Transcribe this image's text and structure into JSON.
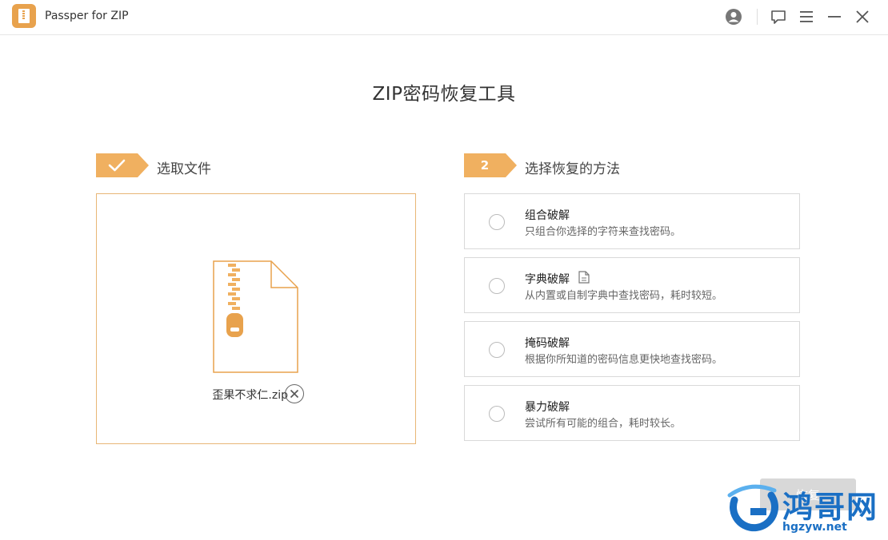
{
  "window": {
    "title": "Passper for ZIP"
  },
  "page": {
    "title": "ZIP密码恢复工具"
  },
  "step1": {
    "label": "选取文件",
    "file_name": "歪果不求仁.zip"
  },
  "step2": {
    "number": "2",
    "label": "选择恢复的方法",
    "methods": [
      {
        "title": "组合破解",
        "desc": "只组合你选择的字符来查找密码。"
      },
      {
        "title": "字典破解",
        "desc": "从内置或自制字典中查找密码，耗时较短。"
      },
      {
        "title": "掩码破解",
        "desc": "根据你所知道的密码信息更快地查找密码。"
      },
      {
        "title": "暴力破解",
        "desc": "尝试所有可能的组合，耗时较长。"
      }
    ]
  },
  "footer": {
    "next_label": "恢复"
  },
  "watermark": {
    "text": "鸿哥网",
    "url": "hgzyw.net"
  },
  "colors": {
    "accent": "#f0b060",
    "file_border": "#e8b676",
    "watermark": "#1a6fc4"
  }
}
